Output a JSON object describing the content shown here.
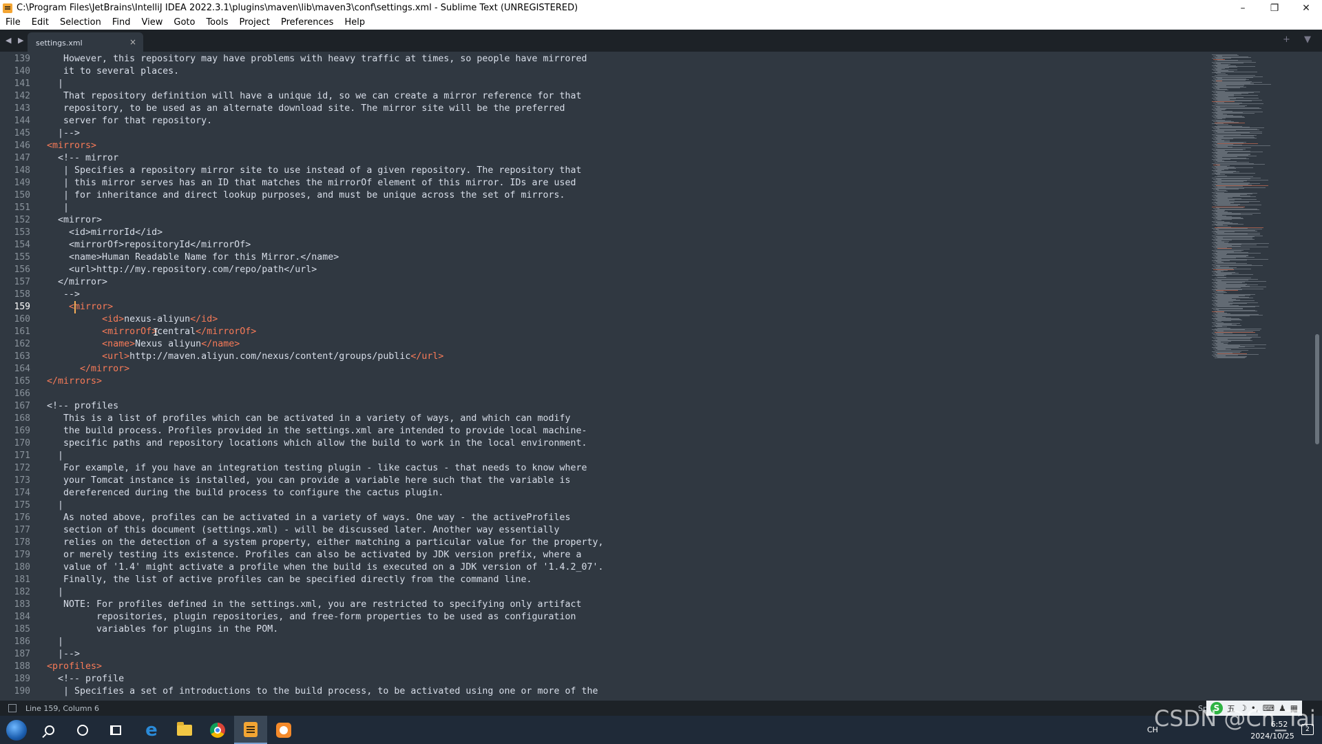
{
  "window": {
    "title": "C:\\Program Files\\JetBrains\\IntelliJ IDEA 2022.3.1\\plugins\\maven\\lib\\maven3\\conf\\settings.xml - Sublime Text (UNREGISTERED)",
    "minimize": "–",
    "maximize": "❐",
    "close": "✕"
  },
  "menu": [
    "File",
    "Edit",
    "Selection",
    "Find",
    "View",
    "Goto",
    "Tools",
    "Project",
    "Preferences",
    "Help"
  ],
  "tabs": {
    "nav_arrows": "◀ ▶",
    "active_tab": "settings.xml",
    "close_glyph": "×",
    "right_controls": "+ ▼"
  },
  "editor": {
    "current_line": 159,
    "lines": [
      {
        "n": "139",
        "t": "   However, this repository may have problems with heavy traffic at times, so people have mirrored"
      },
      {
        "n": "140",
        "t": "   it to several places."
      },
      {
        "n": "141",
        "t": "  |"
      },
      {
        "n": "142",
        "t": "   That repository definition will have a unique id, so we can create a mirror reference for that"
      },
      {
        "n": "143",
        "t": "   repository, to be used as an alternate download site. The mirror site will be the preferred"
      },
      {
        "n": "144",
        "t": "   server for that repository."
      },
      {
        "n": "145",
        "t": "  |-->"
      },
      {
        "n": "146",
        "t": "<mirrors>"
      },
      {
        "n": "147",
        "t": "  <!-- mirror"
      },
      {
        "n": "148",
        "t": "   | Specifies a repository mirror site to use instead of a given repository. The repository that"
      },
      {
        "n": "149",
        "t": "   | this mirror serves has an ID that matches the mirrorOf element of this mirror. IDs are used"
      },
      {
        "n": "150",
        "t": "   | for inheritance and direct lookup purposes, and must be unique across the set of mirrors."
      },
      {
        "n": "151",
        "t": "   |"
      },
      {
        "n": "152",
        "t": "  <mirror>"
      },
      {
        "n": "153",
        "t": "    <id>mirrorId</id>"
      },
      {
        "n": "154",
        "t": "    <mirrorOf>repositoryId</mirrorOf>"
      },
      {
        "n": "155",
        "t": "    <name>Human Readable Name for this Mirror.</name>"
      },
      {
        "n": "156",
        "t": "    <url>http://my.repository.com/repo/path</url>"
      },
      {
        "n": "157",
        "t": "  </mirror>"
      },
      {
        "n": "158",
        "t": "   -->"
      },
      {
        "n": "159",
        "t": "    <mirror>"
      },
      {
        "n": "160",
        "t": "          <id>nexus-aliyun</id>"
      },
      {
        "n": "161",
        "t": "          <mirrorOf>central</mirrorOf>"
      },
      {
        "n": "162",
        "t": "          <name>Nexus aliyun</name>"
      },
      {
        "n": "163",
        "t": "          <url>http://maven.aliyun.com/nexus/content/groups/public</url>"
      },
      {
        "n": "164",
        "t": "      </mirror>"
      },
      {
        "n": "165",
        "t": "</mirrors>"
      },
      {
        "n": "166",
        "t": ""
      },
      {
        "n": "167",
        "t": "<!-- profiles"
      },
      {
        "n": "168",
        "t": "   This is a list of profiles which can be activated in a variety of ways, and which can modify"
      },
      {
        "n": "169",
        "t": "   the build process. Profiles provided in the settings.xml are intended to provide local machine-"
      },
      {
        "n": "170",
        "t": "   specific paths and repository locations which allow the build to work in the local environment."
      },
      {
        "n": "171",
        "t": "  |"
      },
      {
        "n": "172",
        "t": "   For example, if you have an integration testing plugin - like cactus - that needs to know where"
      },
      {
        "n": "173",
        "t": "   your Tomcat instance is installed, you can provide a variable here such that the variable is"
      },
      {
        "n": "174",
        "t": "   dereferenced during the build process to configure the cactus plugin."
      },
      {
        "n": "175",
        "t": "  |"
      },
      {
        "n": "176",
        "t": "   As noted above, profiles can be activated in a variety of ways. One way - the activeProfiles"
      },
      {
        "n": "177",
        "t": "   section of this document (settings.xml) - will be discussed later. Another way essentially"
      },
      {
        "n": "178",
        "t": "   relies on the detection of a system property, either matching a particular value for the property,"
      },
      {
        "n": "179",
        "t": "   or merely testing its existence. Profiles can also be activated by JDK version prefix, where a"
      },
      {
        "n": "180",
        "t": "   value of '1.4' might activate a profile when the build is executed on a JDK version of '1.4.2_07'."
      },
      {
        "n": "181",
        "t": "   Finally, the list of active profiles can be specified directly from the command line."
      },
      {
        "n": "182",
        "t": "  |"
      },
      {
        "n": "183",
        "t": "   NOTE: For profiles defined in the settings.xml, you are restricted to specifying only artifact"
      },
      {
        "n": "184",
        "t": "         repositories, plugin repositories, and free-form properties to be used as configuration"
      },
      {
        "n": "185",
        "t": "         variables for plugins in the POM."
      },
      {
        "n": "186",
        "t": "  |"
      },
      {
        "n": "187",
        "t": "  |-->"
      },
      {
        "n": "188",
        "t": "<profiles>"
      },
      {
        "n": "189",
        "t": "  <!-- profile"
      },
      {
        "n": "190",
        "t": "   | Specifies a set of introductions to the build process, to be activated using one or more of the"
      }
    ]
  },
  "status": {
    "position": "Line 159, Column 6",
    "spaces": "Spa"
  },
  "taskbar": {
    "apps": [
      "start",
      "search",
      "cortana",
      "task-view",
      "edge",
      "file-explorer",
      "chrome",
      "sublime-text",
      "app"
    ],
    "language": "CH",
    "time": "6:52",
    "date": "2024/10/25",
    "notifications": "2"
  },
  "ime": {
    "brand": "S",
    "mode": "五"
  },
  "watermark": "CSDN @Cn_Tai"
}
